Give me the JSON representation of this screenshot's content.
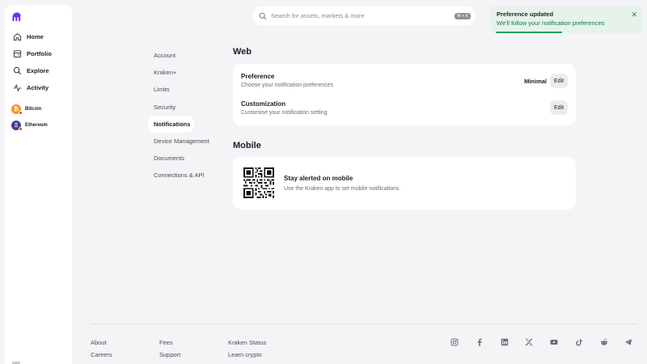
{
  "sidebar": {
    "items": [
      {
        "label": "Home",
        "icon": "home-icon"
      },
      {
        "label": "Portfolio",
        "icon": "portfolio-icon"
      },
      {
        "label": "Explore",
        "icon": "search-icon"
      },
      {
        "label": "Activity",
        "icon": "activity-icon"
      }
    ],
    "assets": [
      {
        "label": "Bitcoin",
        "symbol": "₿",
        "color": "#f7931a"
      },
      {
        "label": "Ethereum",
        "symbol": "Ξ",
        "color": "#4a3d8f"
      }
    ]
  },
  "search": {
    "placeholder": "Search for assets, markets & more",
    "shortcut": "⌘ + K"
  },
  "toast": {
    "title": "Preference updated",
    "message": "We'll follow your notification preferences"
  },
  "settings_nav": [
    "Account",
    "Kraken+",
    "Limits",
    "Security",
    "Notifications",
    "Device Management",
    "Documents",
    "Connections & API"
  ],
  "settings_nav_active": "Notifications",
  "web": {
    "title": "Web",
    "preference": {
      "title": "Preference",
      "subtitle": "Choose your notification preferences",
      "value": "Minimal",
      "button": "Edit"
    },
    "customization": {
      "title": "Customization",
      "subtitle": "Customise your notification setting",
      "button": "Edit"
    }
  },
  "mobile": {
    "title": "Mobile",
    "card_title": "Stay alerted on mobile",
    "card_subtitle": "Use the Kraken app to set mobile notifications."
  },
  "footer": {
    "col1": [
      "About",
      "Careers"
    ],
    "col2": [
      "Fees",
      "Support"
    ],
    "col3": [
      "Kraken Status",
      "Learn crypto"
    ],
    "social": [
      "instagram-icon",
      "facebook-icon",
      "linkedin-icon",
      "x-icon",
      "youtube-icon",
      "tiktok-icon",
      "reddit-icon",
      "telegram-icon"
    ]
  },
  "colors": {
    "brand": "#7132f5",
    "toast_bg": "#e6f3ea",
    "toast_text": "#12783e"
  }
}
